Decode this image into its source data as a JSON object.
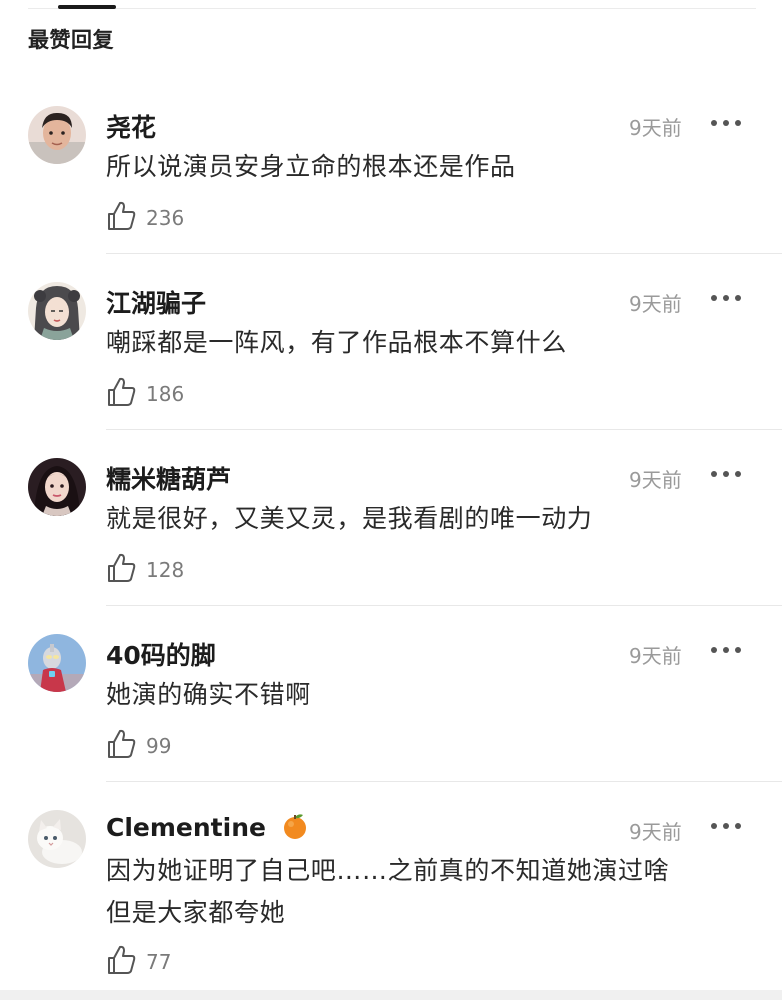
{
  "section": {
    "title": "最赞回复"
  },
  "comments": [
    {
      "username": "尧花",
      "time": "9天前",
      "text": "所以说演员安身立命的根本还是作品",
      "likes": "236",
      "avatar_icon": "avatar-young-man-icon"
    },
    {
      "username": "江湖骗子",
      "time": "9天前",
      "text": "嘲踩都是一阵风，有了作品根本不算什么",
      "likes": "186",
      "avatar_icon": "avatar-ancient-lady-illustration-icon"
    },
    {
      "username": "糯米糖葫芦",
      "time": "9天前",
      "text": "就是很好，又美又灵，是我看剧的唯一动力",
      "likes": "128",
      "avatar_icon": "avatar-young-woman-icon"
    },
    {
      "username": "40码的脚",
      "time": "9天前",
      "text": "她演的确实不错啊",
      "likes": "99",
      "avatar_icon": "avatar-ultraman-figure-icon"
    },
    {
      "username": "Clementine",
      "username_emoji": "orange-fruit-icon",
      "time": "9天前",
      "text_line1": "因为她证明了自己吧……之前真的不知道她演过啥",
      "text_line2": "但是大家都夸她",
      "likes": "77",
      "avatar_icon": "avatar-white-cat-icon"
    }
  ],
  "colors": {
    "text": "#222222",
    "muted": "#9a9a9a",
    "divider": "#e8e8e8",
    "icon": "#555555"
  }
}
